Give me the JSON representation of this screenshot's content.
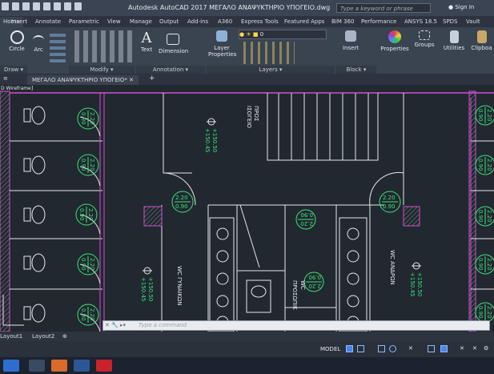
{
  "window": {
    "title": "Autodesk AutoCAD 2017    ΜΕΓΑΛΟ ΑΝΑΨΥΚΤΗΡΙΟ ΥΠΟΓΕΙΟ.dwg",
    "search_placeholder": "Type a keyword or phrase",
    "signin_label": "Sign In"
  },
  "ribbon_tabs": [
    "Home",
    "Insert",
    "Annotate",
    "Parametric",
    "View",
    "Manage",
    "Output",
    "Add-ins",
    "A360",
    "Express Tools",
    "Featured Apps",
    "BIM 360",
    "Performance",
    "ANSYS 18.5",
    "SPDS",
    "Vault"
  ],
  "ribbon": {
    "buttons": {
      "circle": "Circle",
      "arc": "Arc",
      "text": "Text",
      "dimension": "Dimension",
      "layer_properties_line1": "Layer",
      "layer_properties_line2": "Properties",
      "insert": "Insert",
      "properties": "Properties",
      "groups": "Groups",
      "utilities": "Utilities",
      "clipboard": "Clipboa"
    },
    "layer_value": "0",
    "panels": {
      "draw": "Draw ▾",
      "modify": "Modify ▾",
      "annotation": "Annotation ▾",
      "layers": "Layers ▾",
      "block": "Block ▾"
    }
  },
  "document_tab": "ΜΕΓΑΛΟ ΑΝΑΨΥΚΤΗΡΙΟ ΥΠΟΓΕΙΟ*",
  "viewport_label": "D Wireframe]",
  "drawing": {
    "heights_left": [
      {
        "top": "2.20",
        "bottom": "0.90"
      },
      {
        "top": "2.20",
        "bottom": "0.90"
      },
      {
        "top": "2.20",
        "bottom": "0.90"
      },
      {
        "top": "2.20",
        "bottom": "0.90"
      },
      {
        "top": "2.20",
        "bottom": "0.90"
      }
    ],
    "heights_right": [
      {
        "top": "2.20",
        "bottom": "0.90"
      },
      {
        "top": "2.20",
        "bottom": "0.90"
      },
      {
        "top": "2.20",
        "bottom": "0.90"
      },
      {
        "top": "2.20",
        "bottom": "0.90"
      },
      {
        "top": "2.20",
        "bottom": "0.90"
      }
    ],
    "height_mid": {
      "top": "2.20",
      "bottom": "0.90"
    },
    "height_corr_right": {
      "top": "2.20",
      "bottom": "0.90"
    },
    "height_small_1": {
      "top": "2.20",
      "bottom": "0.90"
    },
    "height_small_2": {
      "top": "2.20",
      "bottom": "0.90"
    },
    "level_top": {
      "line1": "+150.50",
      "line2": "+150.45"
    },
    "level_left": {
      "line1": "+150.50",
      "line2": "+150.45"
    },
    "level_right": {
      "line1": "+150.50",
      "line2": "+150.45"
    },
    "stair_label": {
      "line1": "ΠΡΟΣ",
      "line2": "ΙΣΟΓΕΙΟ"
    },
    "wc_women": "WC ΓΥΝΑΙΚΩΝ",
    "wc_men": "WC ΑΝΔΡΩΝ",
    "wc_small": {
      "line1": "WC",
      "line2": "ΠΡΟΣΩΠΙΚ"
    }
  },
  "command_line": {
    "placeholder": "Type a command"
  },
  "layout_tabs": [
    "Layout1",
    "Layout2"
  ],
  "status": {
    "model": "MODEL"
  },
  "colors": {
    "wall_magenta": "#d44fd0",
    "text_green": "#3fe07a",
    "ribbon_bg": "#3a4350",
    "canvas_bg": "#212830"
  }
}
